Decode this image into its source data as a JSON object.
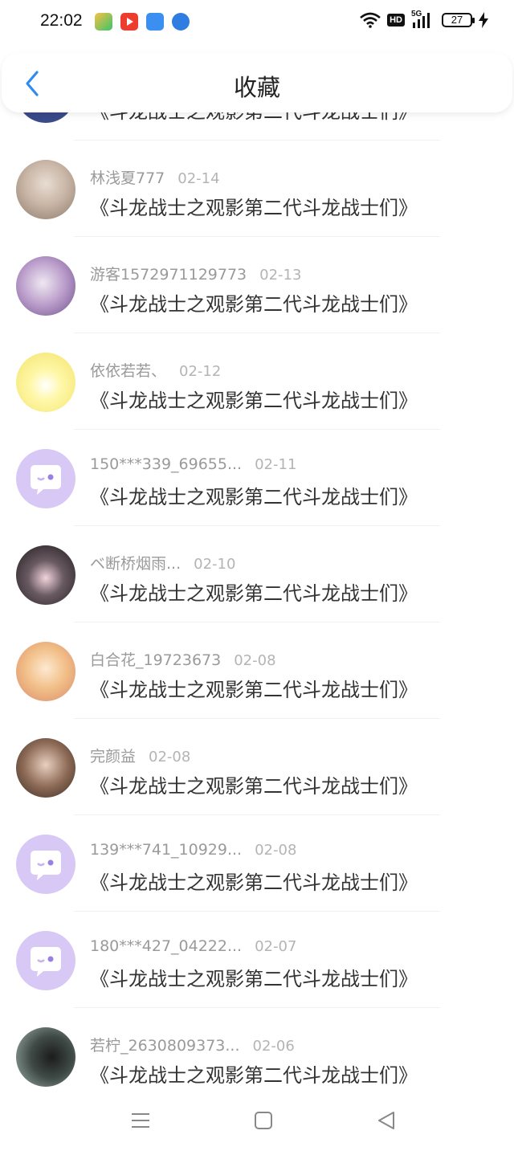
{
  "status_bar": {
    "time": "22:02",
    "battery": "27",
    "network": "5G",
    "hd_label": "HD"
  },
  "header": {
    "title": "收藏"
  },
  "list": {
    "top_partial_title": "《斗龙战士之观影第二代斗龙战士们》",
    "items": [
      {
        "name": "林浅夏777",
        "date": "02-14",
        "title": "《斗龙战士之观影第二代斗龙战士们》"
      },
      {
        "name": "游客1572971129773",
        "date": "02-13",
        "title": "《斗龙战士之观影第二代斗龙战士们》"
      },
      {
        "name": "依依若若、",
        "date": "02-12",
        "title": "《斗龙战士之观影第二代斗龙战士们》"
      },
      {
        "name": "150***339_69655...",
        "date": "02-11",
        "title": "《斗龙战士之观影第二代斗龙战士们》"
      },
      {
        "name": "ベ断桥烟雨...",
        "date": "02-10",
        "title": "《斗龙战士之观影第二代斗龙战士们》"
      },
      {
        "name": "白合花_19723673",
        "date": "02-08",
        "title": "《斗龙战士之观影第二代斗龙战士们》"
      },
      {
        "name": "完颜益",
        "date": "02-08",
        "title": "《斗龙战士之观影第二代斗龙战士们》"
      },
      {
        "name": "139***741_10929...",
        "date": "02-08",
        "title": "《斗龙战士之观影第二代斗龙战士们》"
      },
      {
        "name": "180***427_04222...",
        "date": "02-07",
        "title": "《斗龙战士之观影第二代斗龙战士们》"
      },
      {
        "name": "若柠_2630809373...",
        "date": "02-06",
        "title": "《斗龙战士之观影第二代斗龙战士们》"
      }
    ]
  },
  "colors": {
    "accent": "#2f8cf0",
    "default_avatar": "#d8c8f5",
    "divider": "#f0f0f0"
  }
}
